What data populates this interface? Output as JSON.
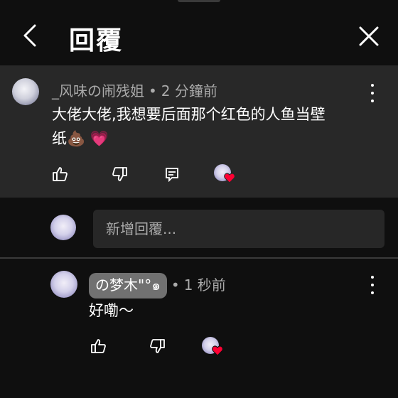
{
  "header": {
    "title": "回覆"
  },
  "original_comment": {
    "author": "_风味の闹残姐",
    "time": "2 分鐘前",
    "text_line1": "大佬大佬,我想要后面那个红色的人鱼当壁",
    "text_line2": "纸",
    "emojis": "💩 💗"
  },
  "reply_box": {
    "placeholder": "新增回覆..."
  },
  "reply": {
    "author": "の梦木\"°๑",
    "time": "1 秒前",
    "text": "好嘞～"
  },
  "colors": {
    "background": "#0f0f0f",
    "highlight": "#282828",
    "heart": "#ff0033"
  }
}
